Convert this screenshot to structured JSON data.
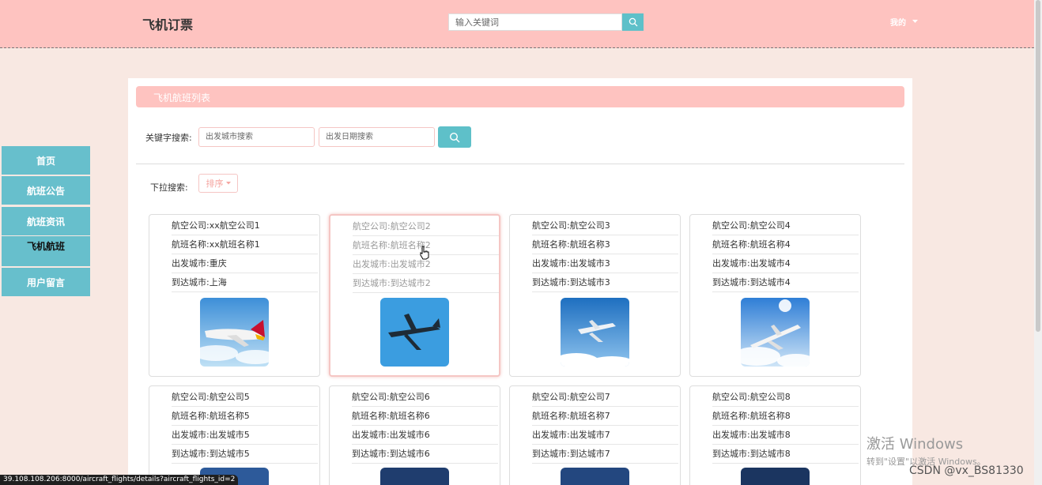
{
  "header": {
    "brand": "飞机订票",
    "search_placeholder": "输入关键词",
    "user_menu": "我的"
  },
  "panel": {
    "title": "飞机航班列表",
    "keyword_label": "关键字搜索:",
    "departure_city_placeholder": "出发城市搜索",
    "departure_date_placeholder": "出发日期搜索",
    "dropdown_label": "下拉搜索:",
    "sort_label": "排序"
  },
  "sidebar": {
    "items": [
      {
        "label": "首页"
      },
      {
        "label": "航班公告"
      },
      {
        "label": "航班资讯"
      },
      {
        "label": "飞机航班"
      },
      {
        "label": "用户留言"
      }
    ]
  },
  "flights": [
    {
      "airline": "航空公司:xx航空公司1",
      "flight_name": "航班名称:xx航班名称1",
      "from": "出发城市:重庆",
      "to": "到达城市:上海"
    },
    {
      "airline": "航空公司:航空公司2",
      "flight_name": "航班名称:航班名称2",
      "from": "出发城市:出发城市2",
      "to": "到达城市:到达城市2"
    },
    {
      "airline": "航空公司:航空公司3",
      "flight_name": "航班名称:航班名称3",
      "from": "出发城市:出发城市3",
      "to": "到达城市:到达城市3"
    },
    {
      "airline": "航空公司:航空公司4",
      "flight_name": "航班名称:航班名称4",
      "from": "出发城市:出发城市4",
      "to": "到达城市:到达城市4"
    },
    {
      "airline": "航空公司:航空公司5",
      "flight_name": "航班名称:航班名称5",
      "from": "出发城市:出发城市5",
      "to": "到达城市:到达城市5"
    },
    {
      "airline": "航空公司:航空公司6",
      "flight_name": "航班名称:航班名称6",
      "from": "出发城市:出发城市6",
      "to": "到达城市:到达城市6"
    },
    {
      "airline": "航空公司:航空公司7",
      "flight_name": "航班名称:航班名称7",
      "from": "出发城市:出发城市7",
      "to": "到达城市:到达城市7"
    },
    {
      "airline": "航空公司:航空公司8",
      "flight_name": "航班名称:航班名称8",
      "from": "出发城市:出发城市8",
      "to": "到达城市:到达城市8"
    }
  ],
  "status_bar": {
    "url": "39.108.108.206:8000/aircraft_flights/details?aircraft_flights_id=2"
  },
  "watermark": {
    "line1": "激活 Windows",
    "line2": "转到\"设置\"以激活 Windows。",
    "csdn": "CSDN @vx_BS81330"
  },
  "colors": {
    "header_bg": "#fec3c0",
    "accent": "#5ec0c9",
    "sidebar_bg": "#67bfcc",
    "page_bg": "#f8e8e2"
  }
}
